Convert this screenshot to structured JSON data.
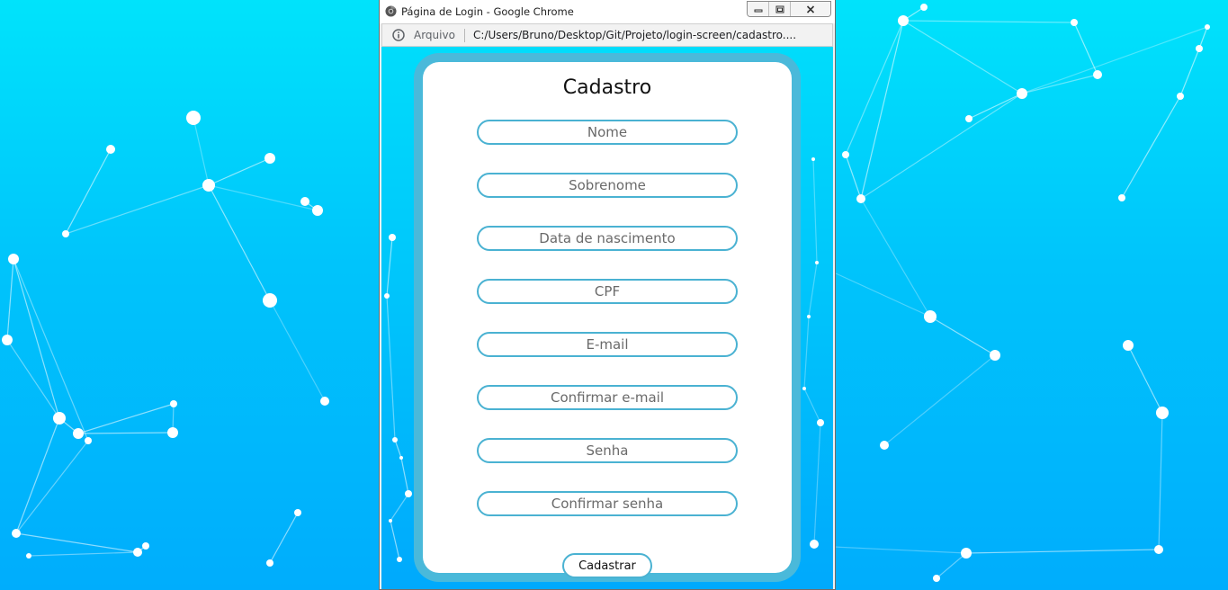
{
  "window": {
    "title": "Página de Login - Google Chrome"
  },
  "addressbar": {
    "origin_label": "Arquivo",
    "url": "C:/Users/Bruno/Desktop/Git/Projeto/login-screen/cadastro...."
  },
  "form": {
    "title": "Cadastro",
    "fields": [
      {
        "placeholder": "Nome",
        "value": ""
      },
      {
        "placeholder": "Sobrenome",
        "value": ""
      },
      {
        "placeholder": "Data de nascimento",
        "value": ""
      },
      {
        "placeholder": "CPF",
        "value": ""
      },
      {
        "placeholder": "E-mail",
        "value": ""
      },
      {
        "placeholder": "Confirmar e-mail",
        "value": ""
      },
      {
        "placeholder": "Senha",
        "value": ""
      },
      {
        "placeholder": "Confirmar senha",
        "value": ""
      }
    ],
    "submit_label": "Cadastrar"
  },
  "colors": {
    "background_top": "#00e3fb",
    "background_bottom": "#00adfc",
    "card_border": "#4ab9da",
    "field_border": "#4ab2d2"
  },
  "icons": {
    "window": "chrome-icon",
    "address": "info-icon",
    "controls": [
      "minimize-icon",
      "restore-icon",
      "close-icon"
    ]
  }
}
